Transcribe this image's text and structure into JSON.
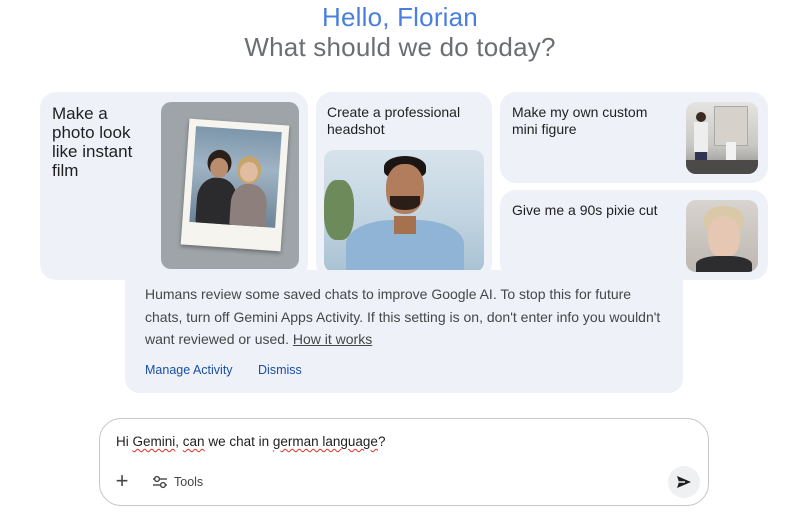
{
  "greeting": {
    "hello": "Hello, Florian",
    "prompt": "What should we do today?"
  },
  "cards": [
    {
      "text": "Make a photo look like instant film",
      "icon": "instant-film-photo"
    },
    {
      "text": "Create a professional headshot",
      "icon": "headshot-photo"
    },
    {
      "text": "Make my own custom mini figure",
      "icon": "mini-figure-photo"
    },
    {
      "text": "Give me a 90s pixie cut",
      "icon": "pixie-cut-photo"
    }
  ],
  "notice": {
    "text": "Humans review some saved chats to improve Google AI. To stop this for future chats, turn off Gemini Apps Activity. If this setting is on, don't enter info you wouldn't want reviewed or used.",
    "link": "How it works",
    "manage": "Manage Activity",
    "dismiss": "Dismiss"
  },
  "composer": {
    "part1": "Hi ",
    "word1": "Gemini",
    "part2": ", ",
    "word2": "can",
    "part3": " we chat in ",
    "word3": "german language",
    "part4": "?",
    "tools_label": "Tools",
    "plus_icon": "plus-icon",
    "send_icon": "send-icon"
  },
  "colors": {
    "hello": "#4a7fe0",
    "card_bg": "#eef2f8",
    "link_blue": "#1a4fa5"
  }
}
